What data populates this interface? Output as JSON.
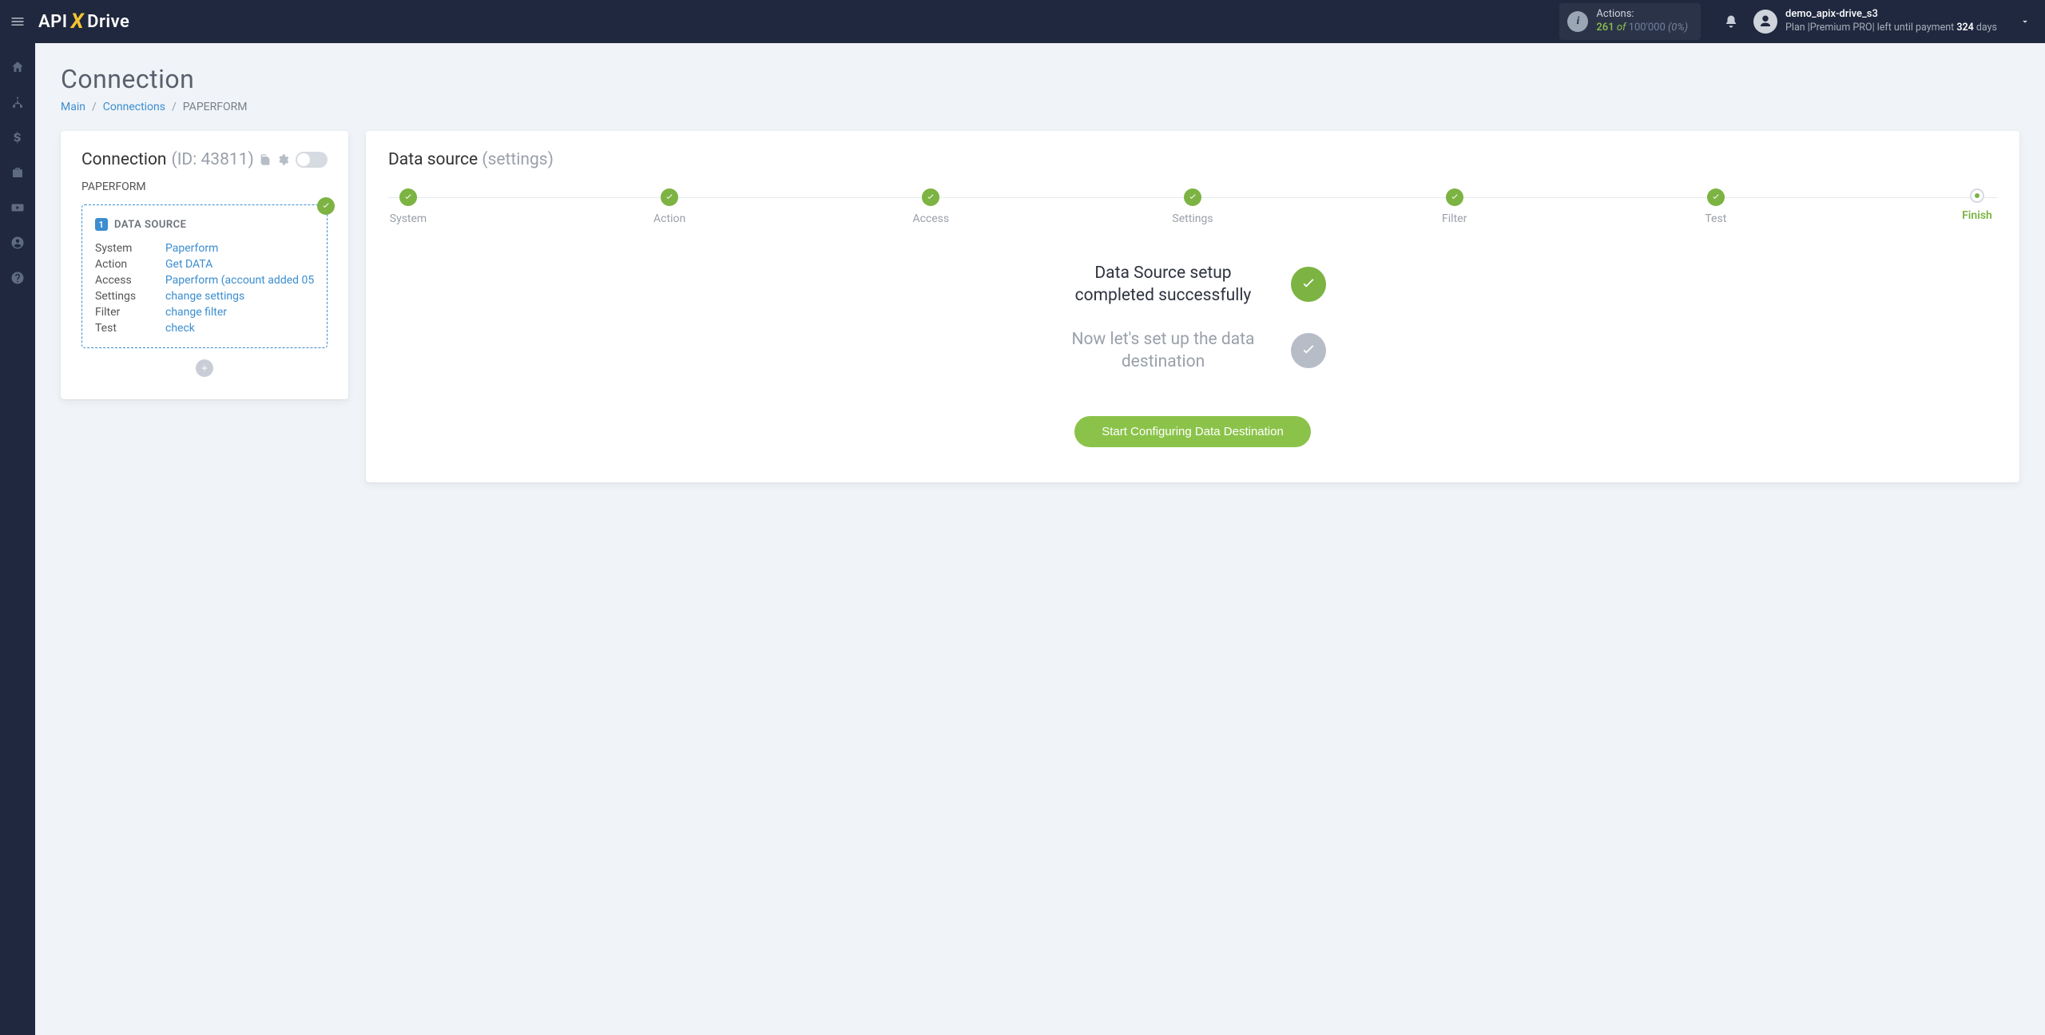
{
  "topbar": {
    "logo": {
      "api": "API",
      "x": "X",
      "drive": "Drive"
    },
    "actions": {
      "label": "Actions:",
      "count": "261",
      "of": "of",
      "total": "100'000",
      "pct": "(0%)"
    },
    "user": {
      "name": "demo_apix-drive_s3",
      "plan_prefix": "Plan |",
      "plan_name": "Premium PRO",
      "plan_mid": "| left until payment ",
      "days": "324",
      "days_suffix": " days"
    }
  },
  "page": {
    "title": "Connection",
    "crumbs": {
      "main": "Main",
      "connections": "Connections",
      "current": "PAPERFORM"
    }
  },
  "left_card": {
    "title": "Connection",
    "id_label": "(ID: 43811)",
    "subtitle": "PAPERFORM",
    "ds": {
      "badge": "1",
      "heading": "DATA SOURCE",
      "rows": [
        {
          "k": "System",
          "v": "Paperform"
        },
        {
          "k": "Action",
          "v": "Get DATA"
        },
        {
          "k": "Access",
          "v": "Paperform (account added 05"
        },
        {
          "k": "Settings",
          "v": "change settings"
        },
        {
          "k": "Filter",
          "v": "change filter"
        },
        {
          "k": "Test",
          "v": "check"
        }
      ]
    }
  },
  "right_card": {
    "title": "Data source",
    "title_muted": "(settings)",
    "steps": [
      "System",
      "Action",
      "Access",
      "Settings",
      "Filter",
      "Test",
      "Finish"
    ],
    "msg_done": "Data Source setup completed successfully",
    "msg_next": "Now let's set up the data destination",
    "cta": "Start Configuring Data Destination"
  }
}
